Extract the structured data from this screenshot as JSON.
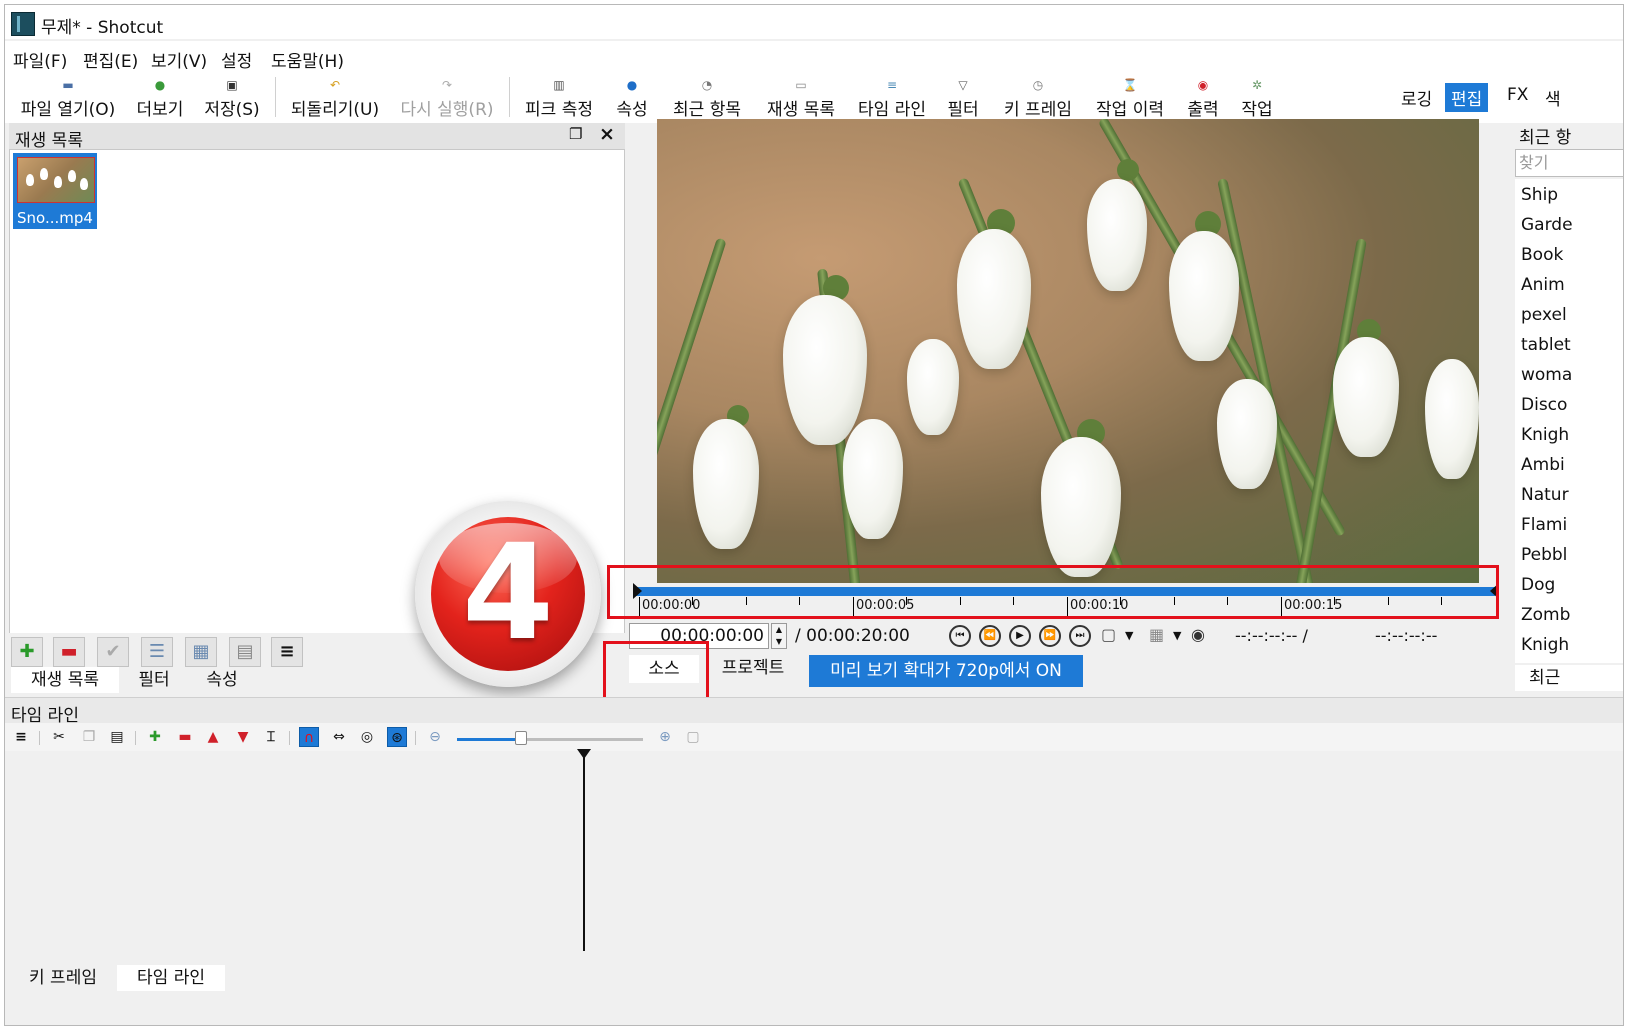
{
  "window": {
    "title": "무제* - Shotcut"
  },
  "menu": [
    "파일(F)",
    "편집(E)",
    "보기(V)",
    "설정",
    "도움말(H)"
  ],
  "toolbar": {
    "open": "파일 열기(O)",
    "more": "더보기",
    "save": "저장(S)",
    "undo": "되돌리기(U)",
    "redo": "다시 실행(R)",
    "peak": "피크 측정",
    "properties": "속성",
    "recent": "최근 항목",
    "playlist": "재생 목록",
    "timeline": "타임 라인",
    "filter": "필터",
    "keyframe": "키 프레임",
    "history": "작업 이력",
    "export": "출력",
    "jobs": "작업"
  },
  "layouts": {
    "logging": "로깅",
    "editing": "편집",
    "fx": "FX",
    "color": "색"
  },
  "playlist": {
    "title": "재생 목록",
    "item_label": "Sno...mp4",
    "tabs": [
      "재생 목록",
      "필터",
      "속성"
    ]
  },
  "player": {
    "timecode": "00:00:00:00",
    "total": "/ 00:00:20:00",
    "in_point": "--:--:--:-- /",
    "out_point": "--:--:--:--",
    "ruler": [
      "00:00:00",
      "00:00:05",
      "00:00:10",
      "00:00:15"
    ],
    "tab_source": "소스",
    "tab_project": "프로젝트",
    "preview_button": "미리 보기 확대가 720p에서 ON"
  },
  "badge": {
    "number": "4"
  },
  "recent": {
    "title": "최근 항",
    "search_placeholder": "찾기",
    "items": [
      "Ship",
      "Garde",
      "Book",
      "Anim",
      "pexel",
      "tablet",
      "woma",
      "Disco",
      "Knigh",
      "Ambi",
      "Natur",
      "Flami",
      "Pebbl",
      "Dog",
      "Zomb",
      "Knigh"
    ],
    "tab": "최근"
  },
  "timeline": {
    "title": "타임 라인",
    "tabs": [
      "키 프레임",
      "타임 라인"
    ]
  },
  "colors": {
    "accent": "#1e7ad6",
    "highlight_box": "#e3101b"
  }
}
